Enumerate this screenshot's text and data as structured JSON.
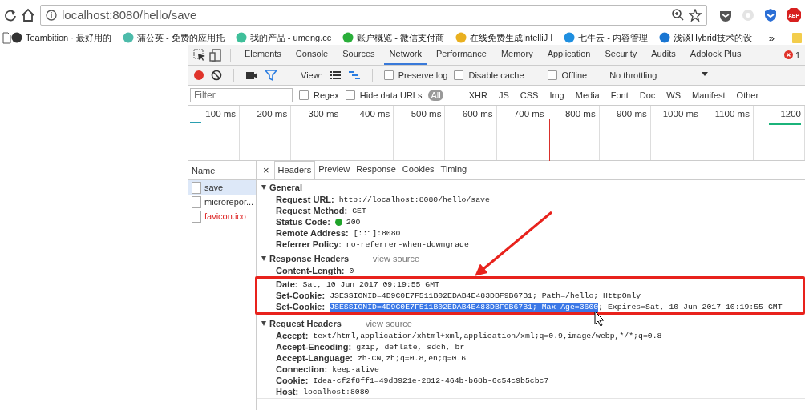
{
  "address_bar": {
    "url": "localhost:8080/hello/save"
  },
  "bookmarks": [
    {
      "label": "Teambition · 最好用的"
    },
    {
      "label": "蒲公英 - 免费的应用托"
    },
    {
      "label": "我的产品 - umeng.cc"
    },
    {
      "label": "账户概览 - 微信支付商"
    },
    {
      "label": "在线免费生成IntelliJ I"
    },
    {
      "label": "七牛云 - 内容管理"
    },
    {
      "label": "浅谈Hybrid技术的设"
    }
  ],
  "bookmarks_more": "»",
  "adblock_badge": "ABP",
  "devtools": {
    "panels": [
      {
        "label": "Elements",
        "selected": false
      },
      {
        "label": "Console",
        "selected": false
      },
      {
        "label": "Sources",
        "selected": false
      },
      {
        "label": "Network",
        "selected": true
      },
      {
        "label": "Performance",
        "selected": false
      },
      {
        "label": "Memory",
        "selected": false
      },
      {
        "label": "Application",
        "selected": false
      },
      {
        "label": "Security",
        "selected": false
      },
      {
        "label": "Audits",
        "selected": false
      },
      {
        "label": "Adblock Plus",
        "selected": false
      }
    ],
    "error_count": "1",
    "toolbar": {
      "view_label": "View:",
      "options": [
        {
          "label": "Preserve log",
          "checked": false
        },
        {
          "label": "Disable cache",
          "checked": false
        },
        {
          "label": "Offline",
          "checked": false
        }
      ],
      "throttling": "No throttling"
    },
    "filter": {
      "placeholder": "Filter",
      "options": [
        {
          "label": "Regex",
          "checked": false
        },
        {
          "label": "Hide data URLs",
          "checked": false
        }
      ],
      "types": [
        {
          "label": "All",
          "selected": true
        },
        {
          "label": "XHR",
          "selected": false
        },
        {
          "label": "JS",
          "selected": false
        },
        {
          "label": "CSS",
          "selected": false
        },
        {
          "label": "Img",
          "selected": false
        },
        {
          "label": "Media",
          "selected": false
        },
        {
          "label": "Font",
          "selected": false
        },
        {
          "label": "Doc",
          "selected": false
        },
        {
          "label": "WS",
          "selected": false
        },
        {
          "label": "Manifest",
          "selected": false
        },
        {
          "label": "Other",
          "selected": false
        }
      ]
    },
    "timeline": {
      "ticks": [
        "100 ms",
        "200 ms",
        "300 ms",
        "400 ms",
        "500 ms",
        "600 ms",
        "700 ms",
        "800 ms",
        "900 ms",
        "1000 ms",
        "1100 ms",
        "1200"
      ]
    },
    "requests": {
      "heading": "Name",
      "items": [
        {
          "name": "save",
          "selected": true,
          "failed": false
        },
        {
          "name": "microrepor...",
          "selected": false,
          "failed": false
        },
        {
          "name": "favicon.ico",
          "selected": false,
          "failed": true
        }
      ]
    },
    "close": "×",
    "detail_tabs": [
      {
        "label": "Headers",
        "selected": true
      },
      {
        "label": "Preview",
        "selected": false
      },
      {
        "label": "Response",
        "selected": false
      },
      {
        "label": "Cookies",
        "selected": false
      },
      {
        "label": "Timing",
        "selected": false
      }
    ],
    "sections": [
      {
        "title": "General",
        "expanded": true,
        "rows": [
          {
            "kind": "plain",
            "name": "Request URL:",
            "value": "http://localhost:8080/hello/save"
          },
          {
            "kind": "plain",
            "name": "Request Method:",
            "value": "GET"
          },
          {
            "kind": "status",
            "name": "Status Code:",
            "value": "200",
            "color": "#1fa32a"
          },
          {
            "kind": "plain",
            "name": "Remote Address:",
            "value": "[::1]:8080"
          },
          {
            "kind": "plain",
            "name": "Referrer Policy:",
            "value": "no-referrer-when-downgrade"
          }
        ]
      },
      {
        "title": "Response Headers",
        "expanded": true,
        "view_source": "view source",
        "rows": [
          {
            "kind": "plain",
            "name": "Content-Length:",
            "value": "0"
          },
          {
            "kind": "plain",
            "framed": true,
            "name": "Date:",
            "value": "Sat, 10 Jun 2017 09:19:55 GMT"
          },
          {
            "kind": "plain",
            "framed": true,
            "name": "Set-Cookie:",
            "value": "JSESSIONID=4D9C0E7F511B02EDAB4E483DBF9B67B1; Path=/hello; HttpOnly"
          },
          {
            "kind": "selected",
            "framed": true,
            "name": "Set-Cookie:",
            "value": "JSESSIONID=4D9C0E7F511B02EDAB4E483DBF9B67B1; Max-Age=3600",
            "rest": "; Expires=Sat, 10-Jun-2017 10:19:55 GMT"
          }
        ]
      },
      {
        "title": "Request Headers",
        "expanded": true,
        "view_source": "view source",
        "rows": [
          {
            "kind": "plain",
            "name": "Accept:",
            "value": "text/html,application/xhtml+xml,application/xml;q=0.9,image/webp,*/*;q=0.8"
          },
          {
            "kind": "plain",
            "name": "Accept-Encoding:",
            "value": "gzip, deflate, sdch, br"
          },
          {
            "kind": "plain",
            "name": "Accept-Language:",
            "value": "zh-CN,zh;q=0.8,en;q=0.6"
          },
          {
            "kind": "plain",
            "name": "Connection:",
            "value": "keep-alive"
          },
          {
            "kind": "plain",
            "name": "Cookie:",
            "value": "Idea-cf2f8ff1=49d3921e-2812-464b-b68b-6c54c9b5cbc7"
          },
          {
            "kind": "plain",
            "name": "Host:",
            "value": "localhost:8080"
          }
        ]
      }
    ]
  }
}
